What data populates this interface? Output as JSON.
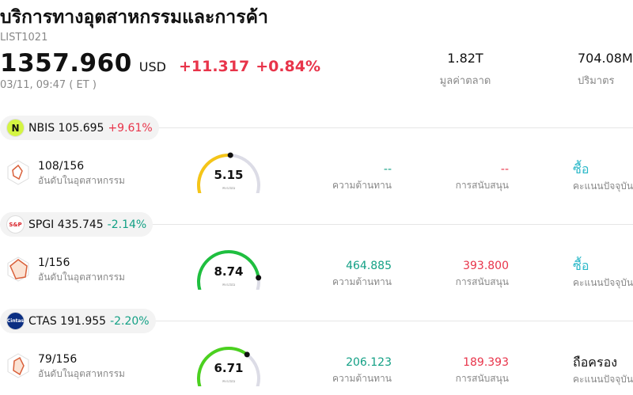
{
  "header": {
    "title": "บริการทางอุตสาหกรรมและการค้า",
    "code": "LIST1021",
    "price": "1357.960",
    "currency": "USD",
    "change": "+11.317",
    "change_pct": "+0.84%",
    "time": "03/11, 09:47  ( ET )"
  },
  "metrics": [
    {
      "value": "1.82T",
      "label": "มูลค่าตลาด"
    },
    {
      "value": "704.08M",
      "label": "ปริมาตร"
    }
  ],
  "stocks": [
    {
      "ticker": "NBIS",
      "price": "105.695",
      "change": "+9.61%",
      "direction": "up",
      "logo_text": "N",
      "logo_color": "#d4f542",
      "logo_fg": "#111111",
      "rank": "108/156",
      "rank_label": "อันดับในอุตสาหกรรม",
      "score": "5.15",
      "score_fraction": 0.515,
      "gauge_color": "#f5c518",
      "score_sub": "คะแนน",
      "resistance": "--",
      "resistance_label": "ความต้านทาน",
      "support": "--",
      "support_label": "การสนับสนุน",
      "rating": "ซื้อ",
      "rating_type": "buy",
      "rating_label": "คะแนนปัจจุบัน"
    },
    {
      "ticker": "SPGI",
      "price": "435.745",
      "change": "-2.14%",
      "direction": "down",
      "logo_text": "S&P",
      "logo_color": "#ffffff",
      "logo_fg": "#d8232a",
      "rank": "1/156",
      "rank_label": "อันดับในอุตสาหกรรม",
      "score": "8.74",
      "score_fraction": 0.874,
      "gauge_color": "#1fbf3f",
      "score_sub": "คะแนน",
      "resistance": "464.885",
      "resistance_label": "ความต้านทาน",
      "support": "393.800",
      "support_label": "การสนับสนุน",
      "rating": "ซื้อ",
      "rating_type": "buy",
      "rating_label": "คะแนนปัจจุบัน"
    },
    {
      "ticker": "CTAS",
      "price": "191.955",
      "change": "-2.20%",
      "direction": "down",
      "logo_text": "Cintas",
      "logo_color": "#0b2e82",
      "logo_fg": "#ffffff",
      "rank": "79/156",
      "rank_label": "อันดับในอุตสาหกรรม",
      "score": "6.71",
      "score_fraction": 0.671,
      "gauge_color": "#4bd11f",
      "score_sub": "คะแนน",
      "resistance": "206.123",
      "resistance_label": "ความต้านทาน",
      "support": "189.393",
      "support_label": "การสนับสนุน",
      "rating": "ถือครอง",
      "rating_type": "hold",
      "rating_label": "คะแนนปัจจุบัน"
    }
  ]
}
